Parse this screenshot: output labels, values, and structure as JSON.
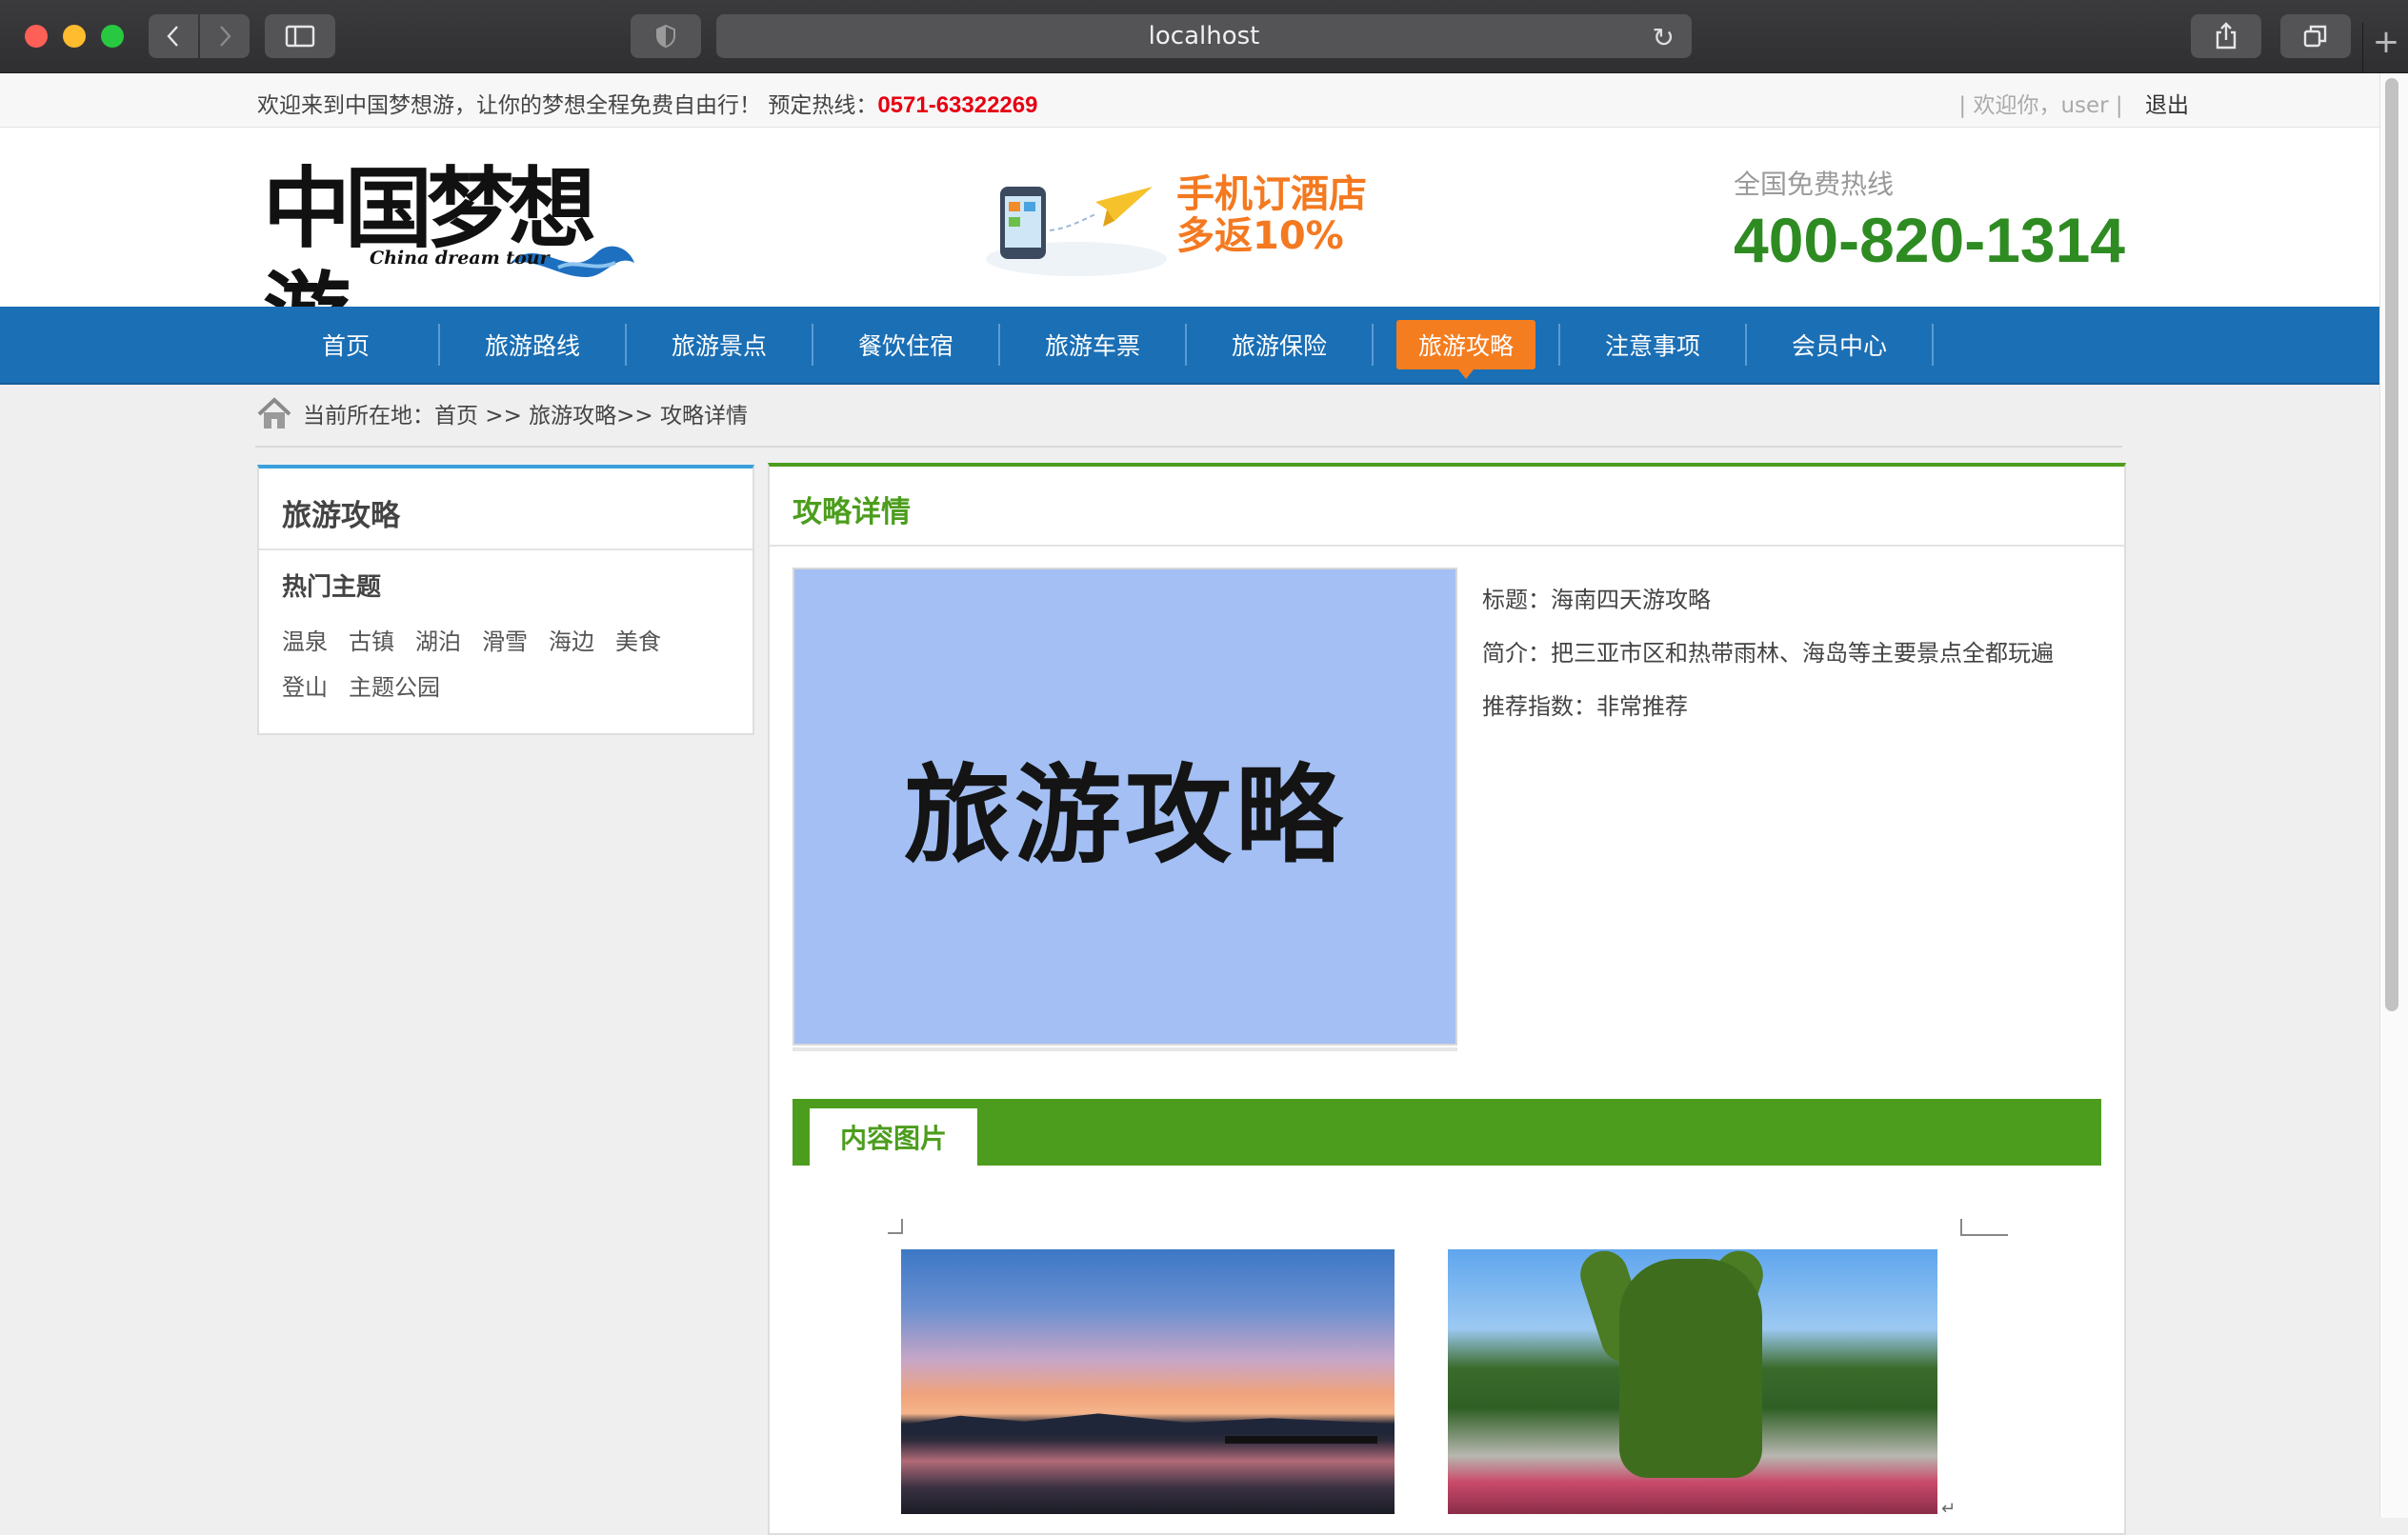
{
  "browser": {
    "url": "localhost"
  },
  "topbar": {
    "welcome": "欢迎来到中国梦想游，让你的梦想全程免费自由行！",
    "hotline_label": "预定热线：",
    "hotline_number": "0571-63322269",
    "user_greeting": "| 欢迎你，user |",
    "logout": "退出"
  },
  "header": {
    "logo_text": "中国梦想游",
    "logo_subtitle": "China dream tour",
    "promo_line1": "手机订酒店",
    "promo_line2": "多返10%",
    "hotline_caption": "全国免费热线",
    "hotline_number": "400-820-1314"
  },
  "nav": {
    "items": [
      {
        "label": "首页"
      },
      {
        "label": "旅游路线"
      },
      {
        "label": "旅游景点"
      },
      {
        "label": "餐饮住宿"
      },
      {
        "label": "旅游车票"
      },
      {
        "label": "旅游保险"
      },
      {
        "label": "旅游攻略",
        "active": true
      },
      {
        "label": "注意事项"
      },
      {
        "label": "会员中心"
      }
    ]
  },
  "breadcrumb": {
    "text": "当前所在地：首页 >> 旅游攻略>> 攻略详情"
  },
  "sidebar": {
    "title": "旅游攻略",
    "subtitle": "热门主题",
    "tags": [
      "温泉",
      "古镇",
      "湖泊",
      "滑雪",
      "海边",
      "美食",
      "登山",
      "主题公园"
    ]
  },
  "main": {
    "title": "攻略详情",
    "cover_text": "旅游攻略",
    "info_title": "标题：海南四天游攻略",
    "info_intro": "简介：把三亚市区和热带雨林、海岛等主要景点全都玩遍",
    "info_rating": "推荐指数：非常推荐",
    "section_tab": "内容图片"
  },
  "colors": {
    "nav_blue": "#1b6fb5",
    "active_orange": "#f47d20",
    "brand_green": "#4c9d1d",
    "hotline_red": "#e60012"
  }
}
